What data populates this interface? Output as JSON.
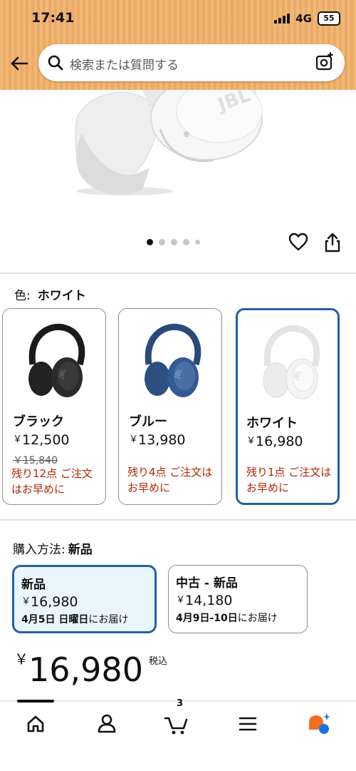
{
  "status_bar": {
    "time": "17:41",
    "network": "4G",
    "battery": "55"
  },
  "search": {
    "placeholder": "検索または質問する"
  },
  "carousel": {
    "total_dots": 5,
    "active_index": 0
  },
  "color_section": {
    "label": "色:",
    "selected_value": "ホワイト",
    "options": [
      {
        "name": "ブラック",
        "currency": "￥",
        "price": "12,500",
        "list_price": "￥15,840",
        "stock": "残り12点 ご注文はお早めに"
      },
      {
        "name": "ブルー",
        "currency": "￥",
        "price": "13,980",
        "stock": "残り4点 ご注文はお早めに"
      },
      {
        "name": "ホワイト",
        "currency": "￥",
        "price": "16,980",
        "stock": "残り1点 ご注文はお早めに"
      }
    ]
  },
  "purchase_section": {
    "label": "購入方法:",
    "selected_value": "新品",
    "options": [
      {
        "title": "新品",
        "currency": "￥",
        "price": "16,980",
        "delivery_date": "4月5日 日曜日",
        "delivery_suffix": "にお届け"
      },
      {
        "title": "中古 - 新品",
        "currency": "￥",
        "price": "14,180",
        "delivery_date": "4月9日-10日",
        "delivery_suffix": "にお届け"
      }
    ]
  },
  "price": {
    "currency": "￥",
    "amount": "16,980",
    "tax_label": "税込"
  },
  "bottom_nav": {
    "cart_count": "3",
    "items": [
      "home-icon",
      "account-icon",
      "cart-icon",
      "menu-icon",
      "rufus-icon"
    ]
  },
  "colors": {
    "header_bg": "#f2b26c",
    "selected_border": "#2162a1",
    "selected_fill": "#eaf6fd",
    "stock_red": "#b12704"
  }
}
